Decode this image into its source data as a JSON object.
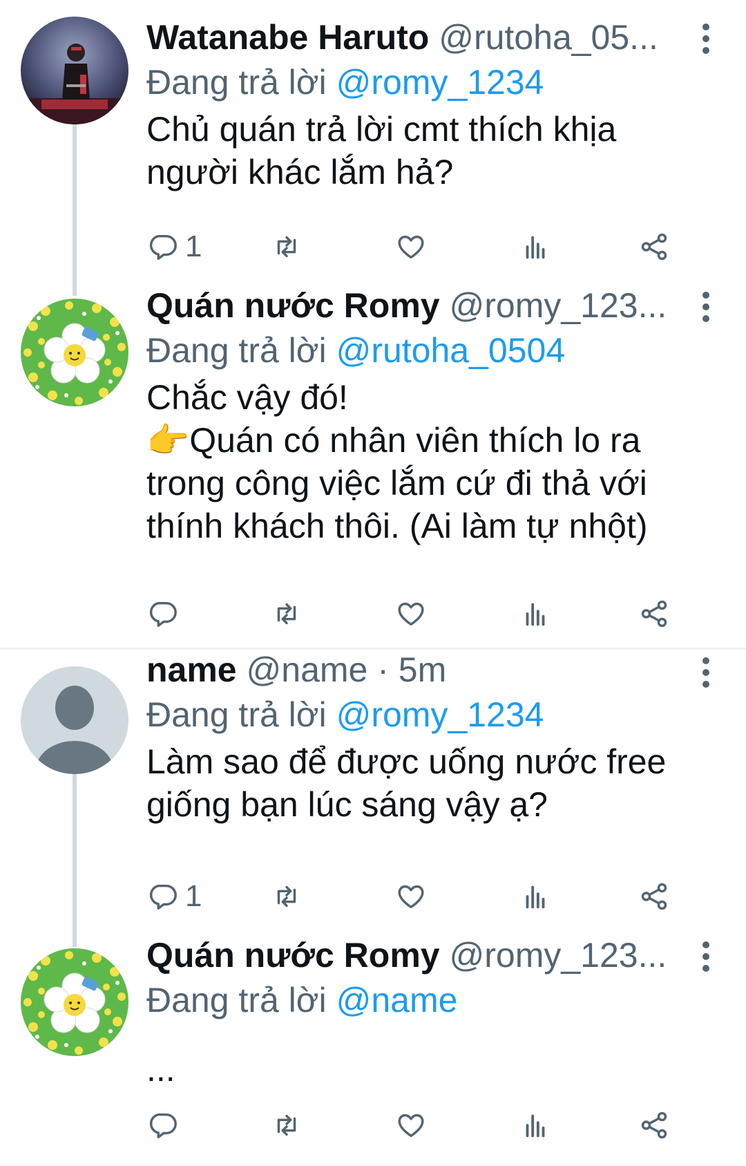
{
  "tweets": [
    {
      "name": "Watanabe Haruto",
      "handle": "@rutoha_05...",
      "time": "",
      "reply_prefix": "Đang trả lời",
      "reply_to": "@romy_1234",
      "text": "Chủ quán trả lời cmt thích khịa\nngười khác lắm hả?",
      "replies_count": "1",
      "avatar": "photo-person-avatar"
    },
    {
      "name": "Quán nước Romy",
      "handle": "@romy_123...",
      "time": "",
      "reply_prefix": "Đang trả lời",
      "reply_to": "@rutoha_0504",
      "text": "Chắc vậy đó!\n👉Quán có nhân viên thích lo ra\ntrong công việc lắm cứ đi thả với\nthính khách thôi. (Ai làm tự nhột)",
      "replies_count": "",
      "avatar": "flower-avatar"
    },
    {
      "name": "name",
      "handle": "@name",
      "time": " · 5m",
      "reply_prefix": "Đang trả lời",
      "reply_to": "@romy_1234",
      "text": "Làm sao để được uống nước free\ngiống bạn lúc sáng vậy ạ?",
      "replies_count": "1",
      "avatar": "default-user-avatar"
    },
    {
      "name": "Quán nước Romy",
      "handle": "@romy_123...",
      "time": "",
      "reply_prefix": "Đang trả lời",
      "reply_to": "@name",
      "text": "...",
      "replies_count": "",
      "avatar": "flower-avatar"
    }
  ],
  "colors": {
    "mention": "#1d9bf0",
    "secondary_text": "#536471",
    "thread_line": "#cfd9de",
    "divider": "#eff3f4"
  },
  "icons": {
    "reply": "reply-icon",
    "retweet": "retweet-icon",
    "like": "like-icon",
    "views": "views-icon",
    "share": "share-icon",
    "more": "more-options-icon"
  }
}
